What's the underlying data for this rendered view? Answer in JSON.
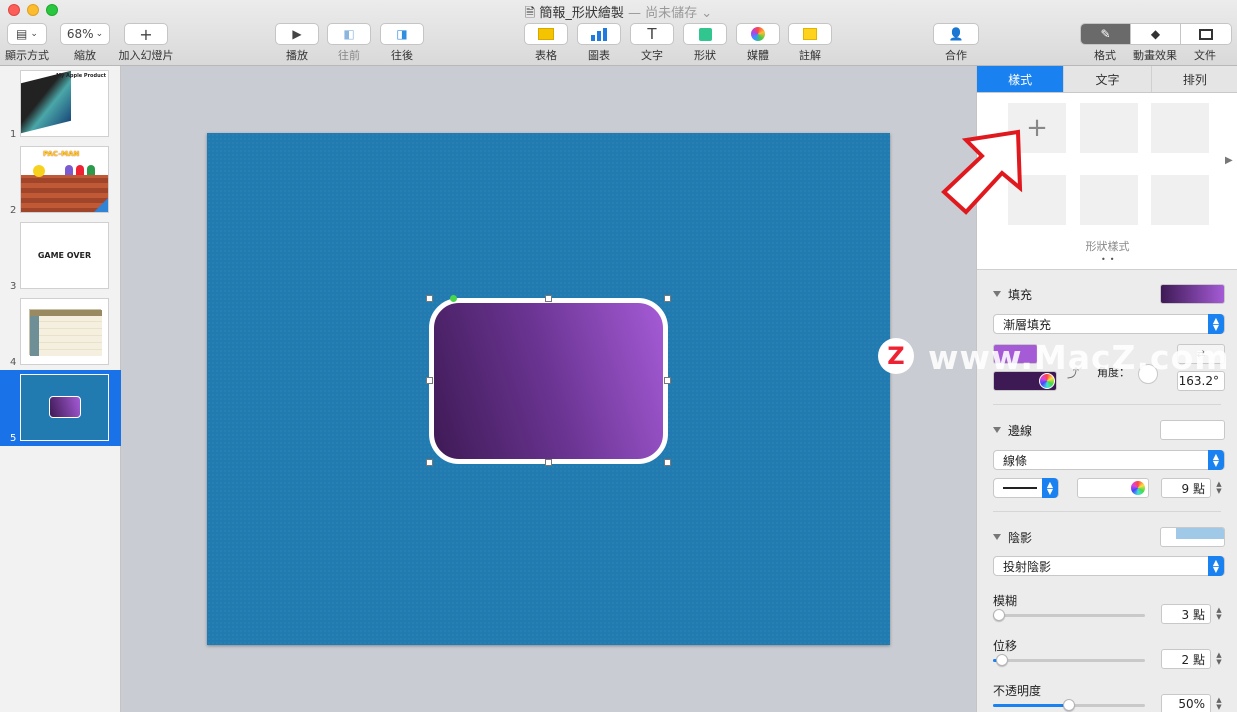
{
  "window": {
    "title": "簡報_形狀繪製",
    "status": "— 尚未儲存 ⌄"
  },
  "toolbar": {
    "view_label": "顯示方式",
    "zoom_value": "68%",
    "zoom_label": "縮放",
    "add_slide_label": "加入幻燈片",
    "play_label": "播放",
    "forward_label": "往前",
    "backward_label": "往後",
    "table_label": "表格",
    "chart_label": "圖表",
    "text_label": "文字",
    "shape_label": "形狀",
    "media_label": "媒體",
    "comment_label": "註解",
    "collab_label": "合作",
    "format_label": "格式",
    "animate_label": "動畫效果",
    "document_label": "文件"
  },
  "navigator": {
    "slides": [
      {
        "num": "1",
        "caption": "My Apple Product"
      },
      {
        "num": "2",
        "caption": "PAC-MAN"
      },
      {
        "num": "3",
        "caption": "GAME OVER"
      },
      {
        "num": "4",
        "caption": ""
      },
      {
        "num": "5",
        "caption": ""
      }
    ]
  },
  "inspector": {
    "tabs": [
      "樣式",
      "文字",
      "排列"
    ],
    "styles_label": "形狀樣式",
    "fill": {
      "label": "填充",
      "type": "漸層填充",
      "angle_label": "角度：",
      "angle_value": "163.2°",
      "color_start": "#3e1a55",
      "color_end": "#a55bd6"
    },
    "border": {
      "label": "邊線",
      "type": "線條",
      "width_value": "9 點"
    },
    "shadow": {
      "label": "陰影",
      "type": "投射陰影",
      "blur_label": "模糊",
      "blur_value": "3 點",
      "blur_level": 0.04,
      "offset_label": "位移",
      "offset_value": "2 點",
      "offset_level": 0.06,
      "opacity_label": "不透明度",
      "opacity_value": "50%",
      "opacity_level": 0.5
    }
  },
  "watermark": {
    "text": "www.MacZ.com",
    "badge": "Z"
  },
  "colors": {
    "accent": "#1a82f0",
    "slide_bg": "#217bb0",
    "arrow": "#e0191e"
  }
}
